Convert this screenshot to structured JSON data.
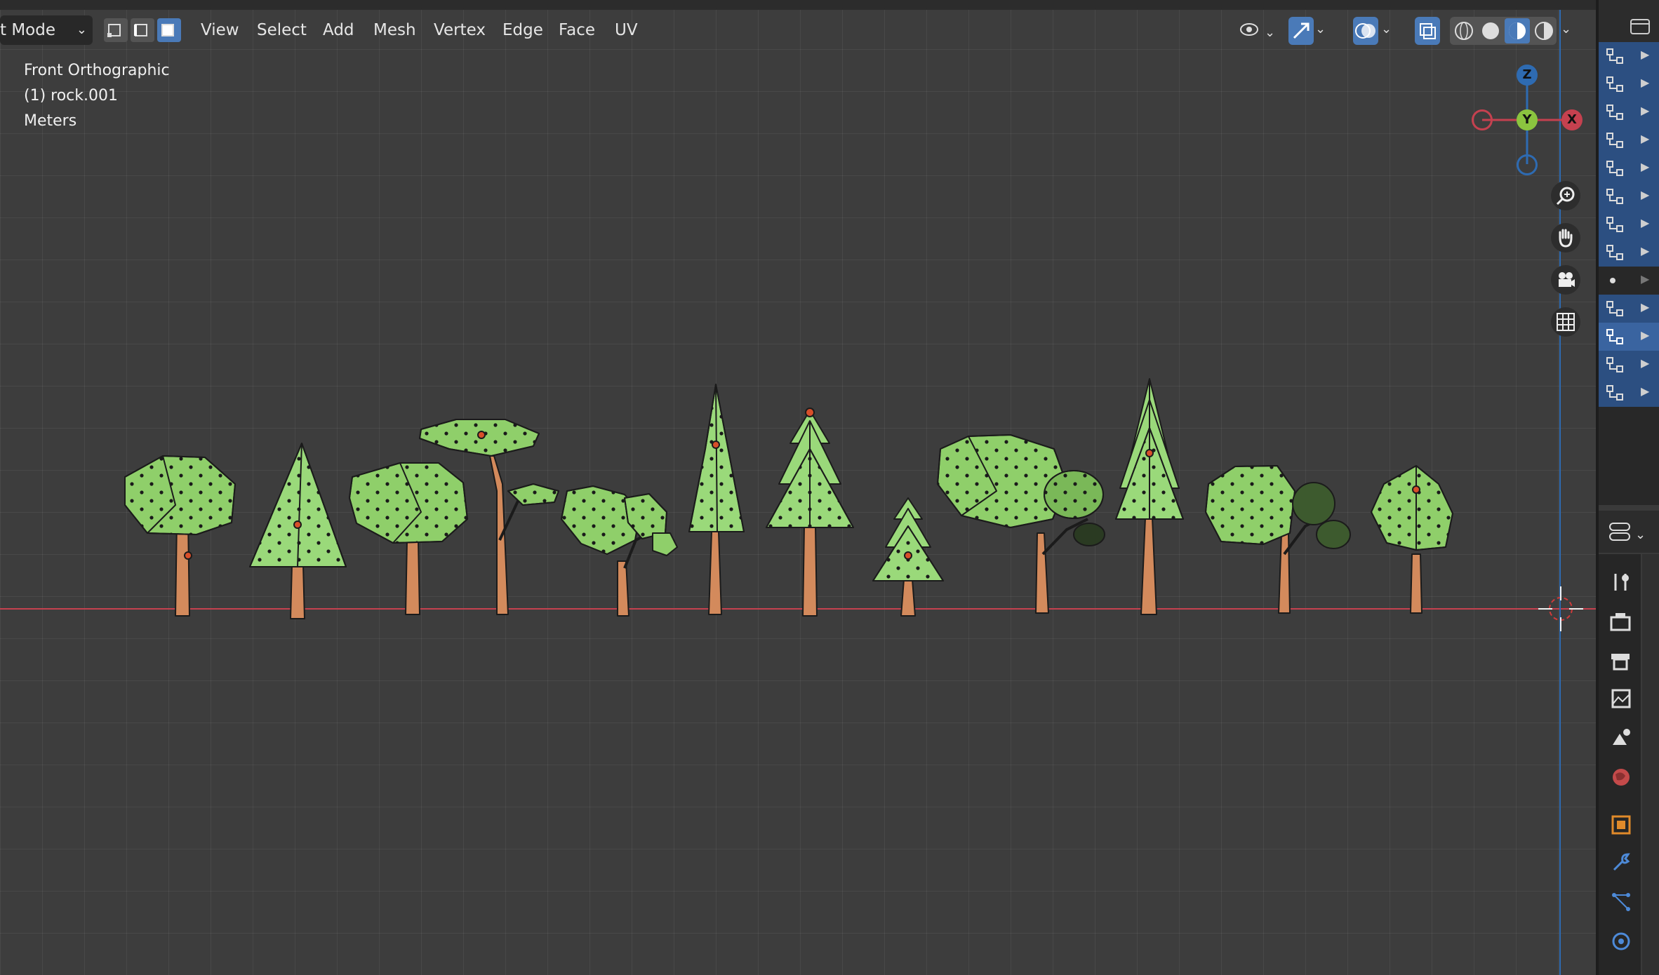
{
  "header": {
    "mode_label": "t Mode",
    "menus": [
      "View",
      "Select",
      "Add",
      "Mesh",
      "Vertex",
      "Edge",
      "Face",
      "UV"
    ]
  },
  "overlay": {
    "view_name": "Front Orthographic",
    "object_name": "(1) rock.001",
    "units": "Meters"
  },
  "gizmo": {
    "z_label": "Z",
    "y_label": "Y",
    "x_label": "X"
  },
  "colors": {
    "x_axis": "#c5414f",
    "y_axis": "#2e6bb2",
    "foliage": "#8fcf6a",
    "trunk": "#d38a5c",
    "selected_row": "#2c4f81"
  },
  "icons": {
    "nav": [
      "zoom-icon",
      "hand-pan-icon",
      "camera-icon",
      "grid-icon"
    ],
    "outliner": [
      "mesh-object-icon"
    ],
    "properties": [
      "tool-icon",
      "render-icon",
      "output-icon",
      "view-layer-icon",
      "scene-icon",
      "world-icon",
      "object-icon",
      "modifier-icon",
      "particles-icon",
      "physics-icon"
    ]
  }
}
